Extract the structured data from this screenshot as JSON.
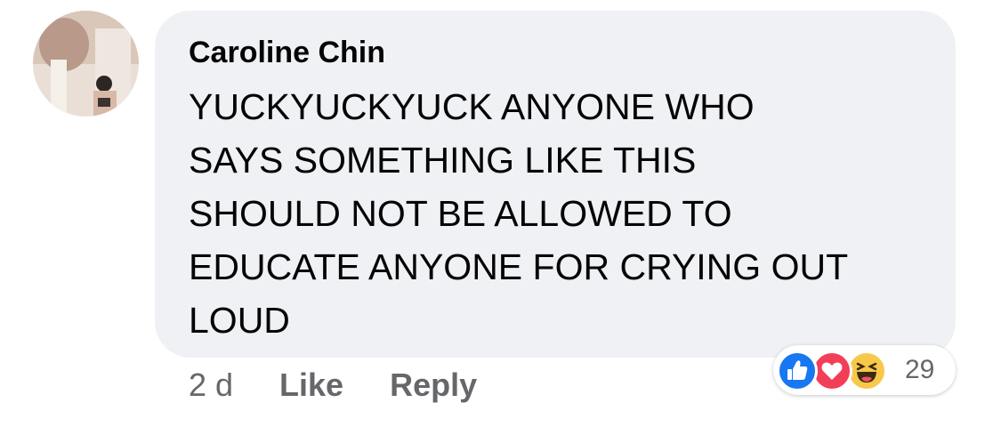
{
  "comment": {
    "author": "Caroline Chin",
    "text": "YUCKYUCKYUCK ANYONE WHO\nSAYS SOMETHING LIKE THIS\nSHOULD NOT BE ALLOWED TO\nEDUCATE ANYONE FOR CRYING OUT\nLOUD",
    "timestamp": "2 d",
    "actions": {
      "like_label": "Like",
      "reply_label": "Reply"
    },
    "reactions": {
      "count": "29",
      "icons": [
        "like-icon",
        "love-icon",
        "haha-icon"
      ]
    }
  },
  "colors": {
    "bubble": "#f0f1f4",
    "like": "#1877f2",
    "love": "#f33e58",
    "haha": "#f7c84a",
    "secondary_text": "#65676b"
  }
}
